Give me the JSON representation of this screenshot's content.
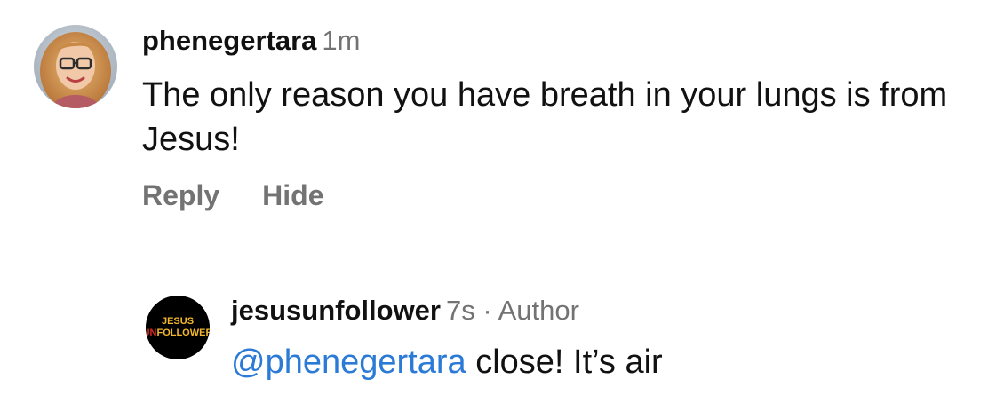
{
  "comment": {
    "username": "phenegertara",
    "time": "1m",
    "text": "The only reason you have breath in your lungs is from Jesus!",
    "actions": {
      "reply_label": "Reply",
      "hide_label": "Hide"
    },
    "avatar_icon": "profile-photo-icon"
  },
  "reply": {
    "username": "jesusunfollower",
    "time": "7s",
    "separator": "·",
    "role": "Author",
    "mention": "@phenegertara",
    "text": " close! It’s air",
    "avatar_logo": {
      "line1": "JESUS",
      "line2_un": "UN",
      "line2_rest": "FOLLOWER"
    },
    "colors": {
      "mention": "#2b7bd6",
      "logo_red": "#d62a1e",
      "logo_gold": "#f2b72b"
    }
  },
  "colors": {
    "text": "#111111",
    "muted": "#737373"
  }
}
